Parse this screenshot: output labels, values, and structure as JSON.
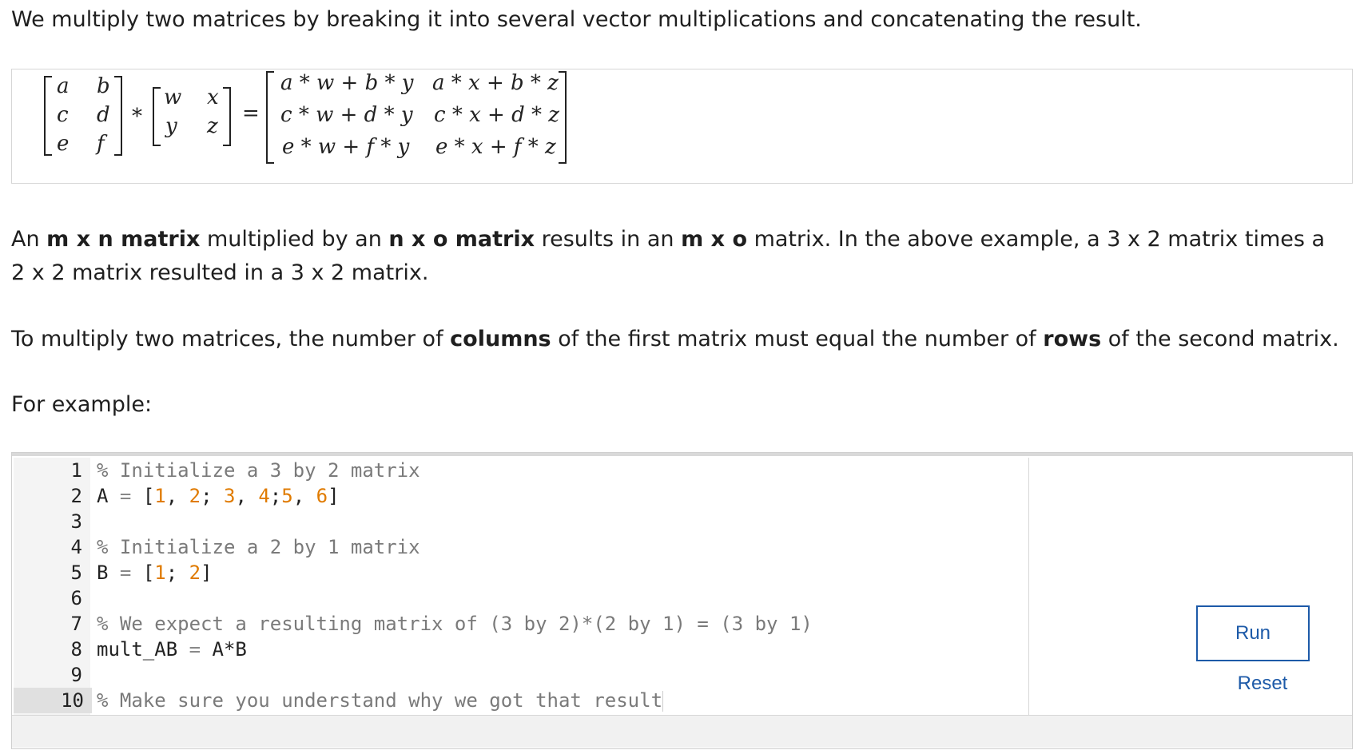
{
  "intro_text": "We multiply two matrices by breaking it into several vector multiplications and concatenating the result.",
  "equation": {
    "left_matrix": [
      [
        "a",
        "b"
      ],
      [
        "c",
        "d"
      ],
      [
        "e",
        "f"
      ]
    ],
    "right_matrix": [
      [
        "w",
        "x"
      ],
      [
        "y",
        "z"
      ]
    ],
    "times": "*",
    "equals": "=",
    "result": [
      [
        "a * w + b * y",
        "a * x + b * z"
      ],
      [
        "c * w + d * y",
        "c * x + d * z"
      ],
      [
        "e * w + f * y",
        "e * x + f * z"
      ]
    ]
  },
  "rule_text": {
    "t1": "An ",
    "b1": "m x n matrix",
    "t2": " multiplied by an ",
    "b2": "n x o matrix",
    "t3": " results in an ",
    "b3": "m x o",
    "t4": " matrix. In the above example, a 3 x 2 matrix times a 2 x 2 matrix resulted in a 3 x 2 matrix."
  },
  "columns_rule": {
    "t1": "To multiply two matrices, the number of ",
    "b1": "columns",
    "t2": " of the first matrix must equal the number of ",
    "b2": "rows",
    "t3": " of the second matrix."
  },
  "example_label": "For example:",
  "editor": {
    "line_numbers": [
      "1",
      "2",
      "3",
      "4",
      "5",
      "6",
      "7",
      "8",
      "9",
      "10"
    ],
    "lines": {
      "l1": "% Initialize a 3 by 2 matrix",
      "l2_a": "A",
      "l2_eq": " = ",
      "l2_open": "[",
      "l2_n1": "1",
      "l2_s1": ", ",
      "l2_n2": "2",
      "l2_s2": "; ",
      "l2_n3": "3",
      "l2_s3": ", ",
      "l2_n4": "4",
      "l2_s4": ";",
      "l2_n5": "5",
      "l2_s5": ", ",
      "l2_n6": "6",
      "l2_close": "]",
      "l4": "% Initialize a 2 by 1 matrix",
      "l5_a": "B",
      "l5_eq": " = ",
      "l5_open": "[",
      "l5_n1": "1",
      "l5_s1": "; ",
      "l5_n2": "2",
      "l5_close": "]",
      "l7": "% We expect a resulting matrix of (3 by 2)*(2 by 1) = (3 by 1)",
      "l8_a": "mult_AB",
      "l8_eq": " = ",
      "l8_b": "A*B",
      "l10": "% Make sure you understand why we got that result"
    },
    "run_label": "Run",
    "reset_label": "Reset"
  }
}
